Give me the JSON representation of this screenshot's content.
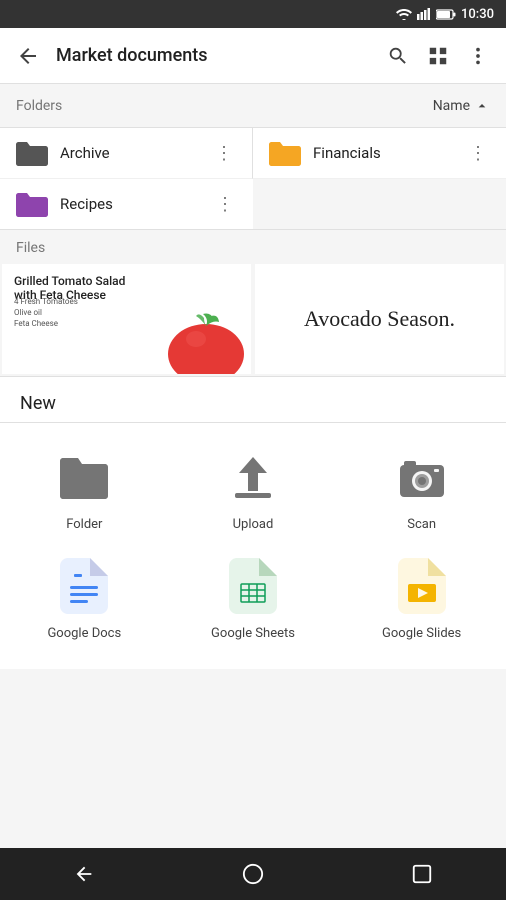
{
  "statusBar": {
    "time": "10:30"
  },
  "appBar": {
    "title": "Market documents",
    "backLabel": "back",
    "searchLabel": "search",
    "gridLabel": "grid view",
    "moreLabel": "more options"
  },
  "sortBar": {
    "foldersLabel": "Folders",
    "sortLabel": "Name",
    "sortDirection": "ascending"
  },
  "folders": [
    {
      "name": "Archive",
      "color": "#555",
      "id": "archive"
    },
    {
      "name": "Financials",
      "color": "#F5A623",
      "id": "financials"
    },
    {
      "name": "Recipes",
      "color": "#8E44AD",
      "id": "recipes"
    }
  ],
  "filesSection": {
    "label": "Files"
  },
  "files": [
    {
      "title": "Grilled Tomato Salad with Feta Cheese",
      "type": "recipe"
    },
    {
      "title": "Avocado Season.",
      "type": "text"
    }
  ],
  "newPanel": {
    "title": "New",
    "items": [
      {
        "id": "folder",
        "label": "Folder",
        "iconType": "folder"
      },
      {
        "id": "upload",
        "label": "Upload",
        "iconType": "upload"
      },
      {
        "id": "scan",
        "label": "Scan",
        "iconType": "scan"
      },
      {
        "id": "google-docs",
        "label": "Google Docs",
        "iconType": "docs"
      },
      {
        "id": "google-sheets",
        "label": "Google Sheets",
        "iconType": "sheets"
      },
      {
        "id": "google-slides",
        "label": "Google Slides",
        "iconType": "slides"
      }
    ]
  }
}
